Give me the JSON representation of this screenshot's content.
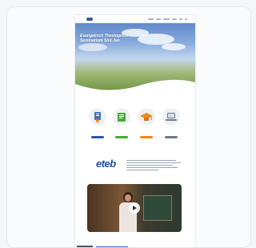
{
  "colors": {
    "accent_blue": "#2c58a6",
    "accent_green": "#4aa832",
    "accent_orange": "#ef8a17",
    "accent_gray": "#6f7b86",
    "brand_blue": "#1f4fa0"
  },
  "nav": {
    "items": [
      "",
      "",
      "",
      "",
      "",
      ""
    ]
  },
  "hero": {
    "title": "Evangelisch Theologisch Seminarium Sint-Jan"
  },
  "features": [
    {
      "icon": "certificate-icon",
      "label": "",
      "button": "",
      "color": "#2c58a6"
    },
    {
      "icon": "book-icon",
      "label": "",
      "button": "",
      "color": "#4aa832"
    },
    {
      "icon": "graduation-cap-icon",
      "label": "",
      "button": "",
      "color": "#ef8a17"
    },
    {
      "icon": "laptop-icon",
      "label": "",
      "button": "",
      "color": "#6f7b86"
    }
  ],
  "brand": {
    "logo": "eteb",
    "tagline": ""
  },
  "video": {
    "icon": "play-icon"
  }
}
